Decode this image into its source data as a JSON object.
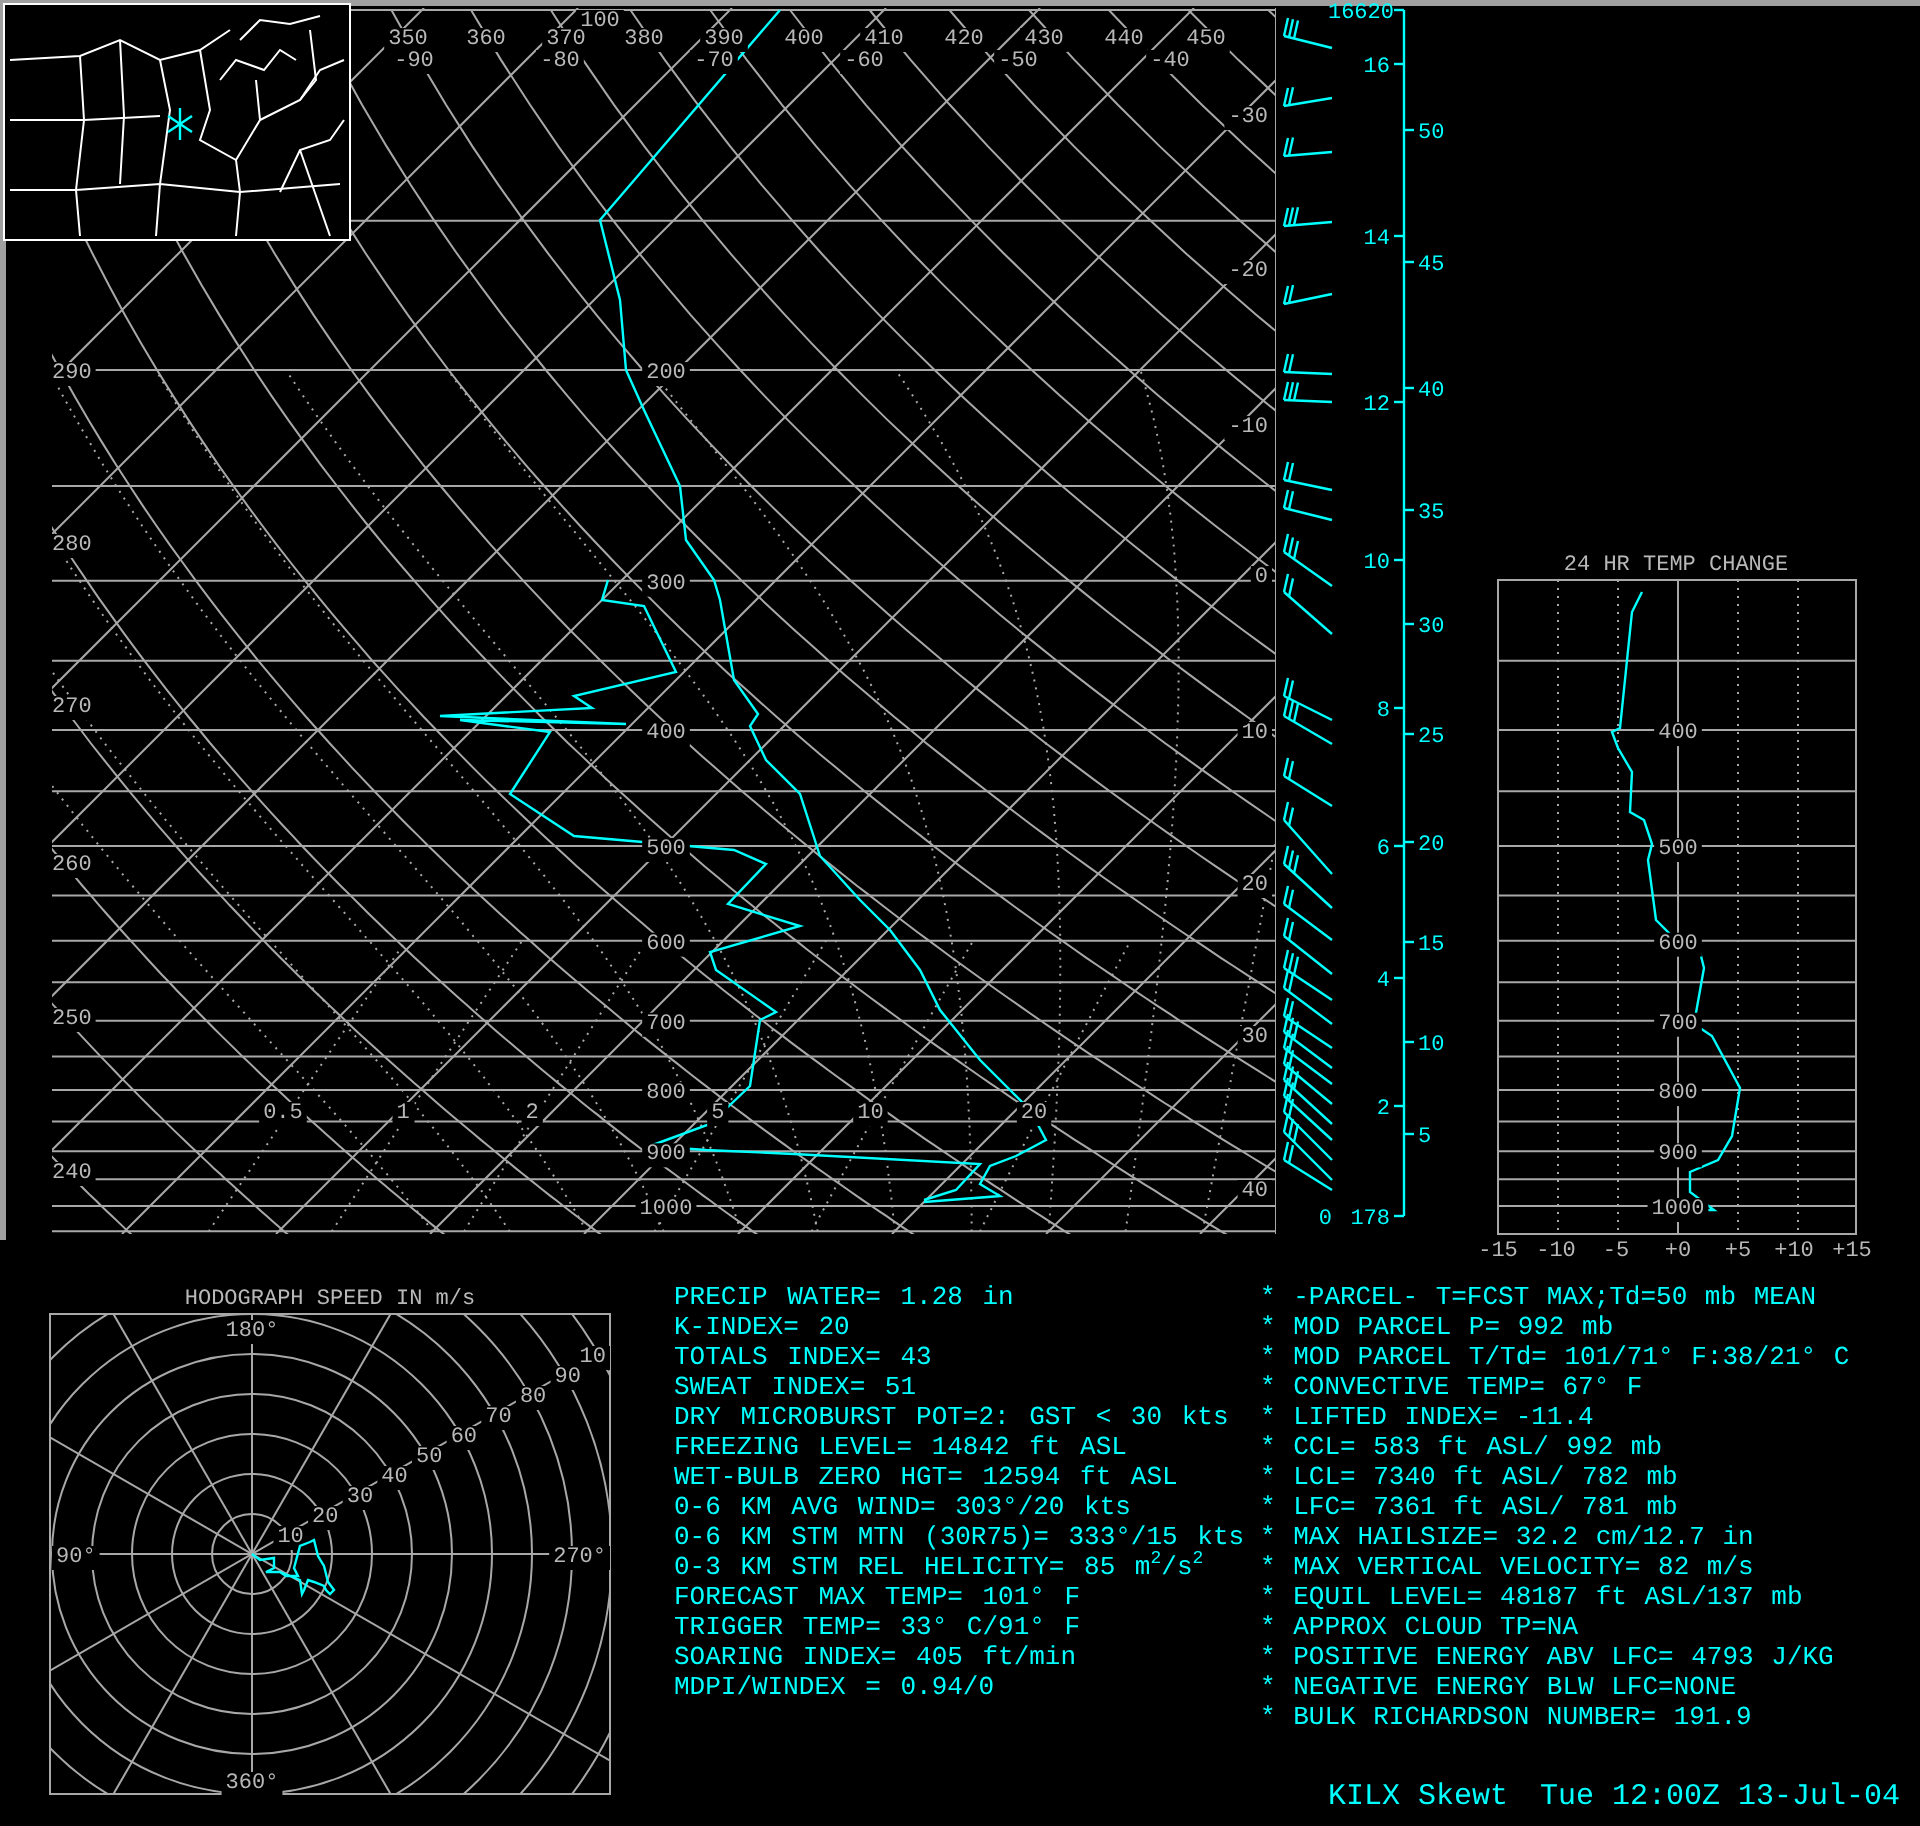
{
  "skewt": {
    "theta_top_labels": [
      "350",
      "360",
      "370",
      "380",
      "390",
      "400",
      "410",
      "420",
      "430",
      "440",
      "450"
    ],
    "temperature_top_labels": [
      "-90",
      "-80",
      "-70",
      "-60",
      "-50",
      "-40"
    ],
    "top_pressure_label": "100",
    "pressure_labels": [
      "200",
      "300",
      "400",
      "500",
      "600",
      "700",
      "800",
      "900",
      "1000"
    ],
    "theta_left_labels": [
      "290",
      "280",
      "270",
      "260",
      "250",
      "240"
    ],
    "isotherm_labels": [
      "-30",
      "-20",
      "-10",
      "0",
      "10",
      "20",
      "30",
      "40"
    ],
    "mixing_ratio_labels": [
      "0.5",
      "1",
      "2",
      "5",
      "10",
      "20"
    ]
  },
  "height_axis": {
    "top_label": "16620",
    "km_labels": [
      "16",
      "14",
      "12",
      "10",
      "8",
      "6",
      "4",
      "2"
    ],
    "zero_label": "0",
    "base_label": "178",
    "kft_labels": [
      "50",
      "45",
      "40",
      "35",
      "30",
      "25",
      "20",
      "15",
      "10",
      "5"
    ]
  },
  "temp_change": {
    "title": "24 HR TEMP CHANGE",
    "pressure_labels": [
      "400",
      "500",
      "600",
      "700",
      "800",
      "900",
      "1000"
    ],
    "x_labels": [
      "-15",
      "-10",
      "-5",
      "+0",
      "+5",
      "+10",
      "+15"
    ]
  },
  "hodograph": {
    "title": "HODOGRAPH SPEED IN m/s",
    "direction_labels": [
      "180°",
      "90°",
      "270°",
      "360°"
    ],
    "speed_labels": [
      "10",
      "20",
      "30",
      "40",
      "50",
      "60",
      "70",
      "80",
      "90",
      "10"
    ]
  },
  "indices_left": [
    "PRECIP WATER= 1.28 in",
    "K-INDEX= 20",
    "TOTALS INDEX= 43",
    "SWEAT INDEX= 51",
    "DRY MICROBURST POT=2: GST < 30 kts",
    "FREEZING LEVEL= 14842 ft ASL",
    "WET-BULB ZERO HGT= 12594 ft ASL",
    "0-6 KM AVG WIND= 303°/20 kts",
    "0-6 KM STM MTN (30R75)= 333°/15 kts",
    "0-3 KM STM REL HELICITY= 85 m$^{2}$/s$^{2}$",
    "FORECAST MAX TEMP= 101° F",
    "TRIGGER TEMP= 33° C/91° F",
    "SOARING INDEX= 405 ft/min",
    "MDPI/WINDEX = 0.94/0"
  ],
  "indices_right": [
    "* -PARCEL- T=FCST MAX;Td=50 mb MEAN",
    "* MOD PARCEL P= 992 mb",
    "* MOD PARCEL T/Td= 101/71° F:38/21° C",
    "* CONVECTIVE TEMP= 67° F",
    "* LIFTED INDEX= -11.4",
    "* CCL= 583 ft ASL/ 992 mb",
    "* LCL= 7340 ft ASL/ 782 mb",
    "* LFC= 7361 ft ASL/ 781 mb",
    "* MAX HAILSIZE= 32.2 cm/12.7 in",
    "* MAX VERTICAL VELOCITY= 82 m/s",
    "* EQUIL LEVEL= 48187 ft ASL/137 mb",
    "* APPROX CLOUD TP=NA",
    "* POSITIVE ENERGY ABV LFC= 4793 J/KG",
    "* NEGATIVE ENERGY BLW LFC=NONE",
    "* BULK RICHARDSON NUMBER= 191.9"
  ],
  "footer": {
    "station": "KILX Skewt",
    "time": "Tue 12:00Z 13-Jul-04"
  }
}
